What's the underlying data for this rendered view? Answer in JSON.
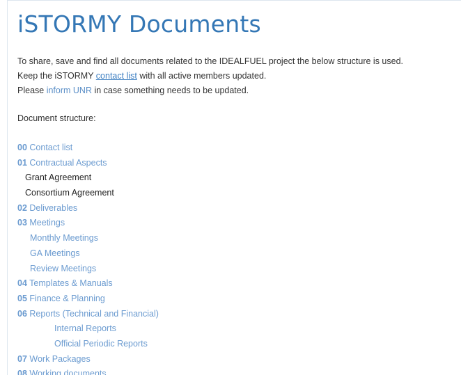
{
  "page": {
    "title": "iSTORMY Documents"
  },
  "intro": {
    "line1": "To share, save and find all documents related to the IDEALFUEL project the below structure is used.",
    "line2_prefix": "Keep the iSTORMY ",
    "line2_link": "contact list",
    "line2_suffix": " with all active members updated.",
    "line3_prefix": "Please ",
    "line3_link": "inform UNR",
    "line3_suffix": " in case something needs to be updated."
  },
  "structure": {
    "label": "Document structure:",
    "items": [
      {
        "num": "00",
        "label": "Contact list"
      },
      {
        "num": "01",
        "label": "Contractual Aspects"
      },
      {
        "num": "",
        "label": "Grant Agreement"
      },
      {
        "num": "",
        "label": "Consortium Agreement"
      },
      {
        "num": "02",
        "label": "Deliverables"
      },
      {
        "num": "03",
        "label": "Meetings"
      },
      {
        "num": "",
        "label": "Monthly Meetings"
      },
      {
        "num": "",
        "label": "GA Meetings"
      },
      {
        "num": "",
        "label": "Review Meetings"
      },
      {
        "num": "04",
        "label": "Templates & Manuals"
      },
      {
        "num": "05",
        "label": "Finance & Planning"
      },
      {
        "num": "06",
        "label": "Reports (Technical and Financial)"
      },
      {
        "num": "",
        "label": "Internal Reports"
      },
      {
        "num": "",
        "label": "Official Periodic Reports"
      },
      {
        "num": "07",
        "label": "Work Packages"
      },
      {
        "num": "08",
        "label": "Working documents"
      }
    ]
  },
  "colors": {
    "title": "#3477b5",
    "link": "#6b9bd0",
    "text": "#333333",
    "border": "#dde6ee"
  }
}
